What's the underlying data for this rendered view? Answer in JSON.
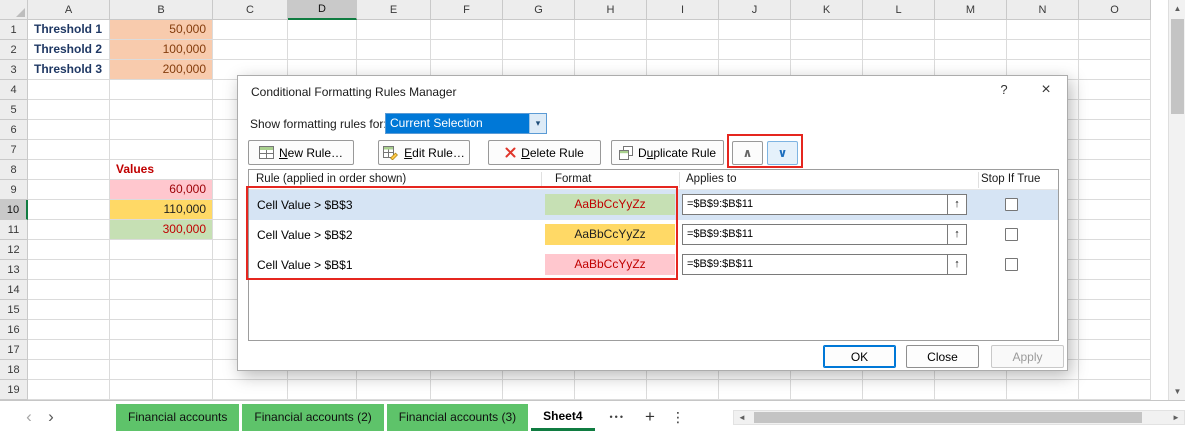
{
  "colors": {
    "accent_green": "#107C41",
    "tab_green": "#5EC36A",
    "annotation_red": "#E5261F",
    "selection_blue": "#0078D7",
    "threshold_fill": "#F8CBAD",
    "rule_green_fill": "#C6E0B4",
    "rule_gold_fill": "#FFD966",
    "rule_pink_fill": "#FFC7CE"
  },
  "icons": {
    "up": "▲",
    "down": "▼",
    "left": "◄",
    "right": "►",
    "combo_arrow": "▾"
  },
  "grid": {
    "columns": [
      "A",
      "B",
      "C",
      "D",
      "E",
      "F",
      "G",
      "H",
      "I",
      "J",
      "K",
      "L",
      "M",
      "N",
      "O"
    ],
    "selected_column": "D",
    "rows": [
      "1",
      "2",
      "3",
      "4",
      "5",
      "6",
      "7",
      "8",
      "9",
      "10",
      "11",
      "12",
      "13",
      "14",
      "15",
      "16",
      "17",
      "18",
      "19"
    ],
    "selected_row": "10",
    "cells": [
      {
        "ref": "A1",
        "text": "Threshold 1",
        "bold": true,
        "color": "#1F3864",
        "align": "left"
      },
      {
        "ref": "A2",
        "text": "Threshold 2",
        "bold": true,
        "color": "#1F3864",
        "align": "left"
      },
      {
        "ref": "A3",
        "text": "Threshold 3",
        "bold": true,
        "color": "#1F3864",
        "align": "left"
      },
      {
        "ref": "B1",
        "text": "50,000",
        "bg": "#F8CBAD",
        "color": "#843C0C",
        "align": "right"
      },
      {
        "ref": "B2",
        "text": "100,000",
        "bg": "#F8CBAD",
        "color": "#843C0C",
        "align": "right"
      },
      {
        "ref": "B3",
        "text": "200,000",
        "bg": "#F8CBAD",
        "color": "#843C0C",
        "align": "right"
      },
      {
        "ref": "B8",
        "text": "Values",
        "bold": true,
        "color": "#C00000",
        "align": "left"
      },
      {
        "ref": "B9",
        "text": "60,000",
        "bg": "#FFC7CE",
        "color": "#9C0006",
        "align": "right"
      },
      {
        "ref": "B10",
        "text": "110,000",
        "bg": "#FFD966",
        "color": "#1F1F1F",
        "align": "right"
      },
      {
        "ref": "B11",
        "text": "300,000",
        "bg": "#C6E0B4",
        "color": "#C00000",
        "align": "right"
      }
    ]
  },
  "dialog": {
    "title": "Conditional Formatting Rules Manager",
    "help_icon": "?",
    "close_icon": "×",
    "show_rules_label": "Show formatting rules for:",
    "show_rules_value": "Current Selection",
    "move_up_icon": "∧",
    "move_down_icon": "∨",
    "toolbar": [
      {
        "label": "New Rule…",
        "accel": 0,
        "icon": "new-rule"
      },
      {
        "label": "Edit Rule…",
        "accel": 0,
        "icon": "edit-rule"
      },
      {
        "label": "Delete Rule",
        "accel": 0,
        "icon": "delete-rule"
      },
      {
        "label": "Duplicate Rule",
        "accel": 1,
        "icon": "duplicate-rule"
      }
    ],
    "list": {
      "headers": {
        "rule": "Rule (applied in order shown)",
        "format": "Format",
        "applies_to": "Applies to",
        "stop": "Stop If True"
      },
      "picker_icon": "↑",
      "rules": [
        {
          "rule": "Cell Value > $B$3",
          "sample": "AaBbCcYyZz",
          "bg": "#C6E0B4",
          "color": "#C00000",
          "applies_to": "=$B$9:$B$11",
          "stop_if_true": false,
          "selected": true
        },
        {
          "rule": "Cell Value > $B$2",
          "sample": "AaBbCcYyZz",
          "bg": "#FFD966",
          "color": "#1F1F1F",
          "applies_to": "=$B$9:$B$11",
          "stop_if_true": false,
          "selected": false
        },
        {
          "rule": "Cell Value > $B$1",
          "sample": "AaBbCcYyZz",
          "bg": "#FFC7CE",
          "color": "#C00000",
          "applies_to": "=$B$9:$B$11",
          "stop_if_true": false,
          "selected": false
        }
      ]
    },
    "buttons": {
      "ok": "OK",
      "close": "Close",
      "apply": "Apply"
    }
  },
  "sheet_bar": {
    "nav_left": "‹",
    "nav_right": "›",
    "tabs": [
      {
        "label": "Financial accounts",
        "type": "green"
      },
      {
        "label": "Financial accounts (2)",
        "type": "green"
      },
      {
        "label": "Financial accounts (3)",
        "type": "green"
      },
      {
        "label": "Sheet4",
        "type": "active"
      }
    ],
    "more_tabs": "•••",
    "add_sheet": "+",
    "all_sheets": "⋮"
  }
}
